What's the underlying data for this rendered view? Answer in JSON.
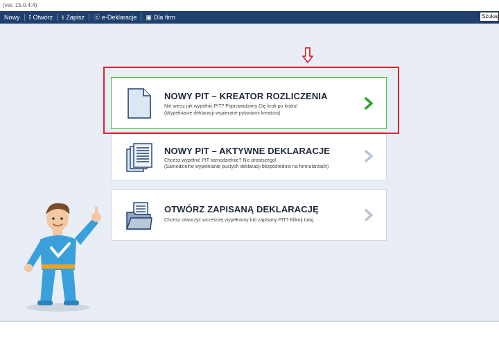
{
  "app": {
    "version": "(ver. 15.0.4.4)"
  },
  "toolbar": {
    "items": [
      {
        "label": "Nowy",
        "icon": ""
      },
      {
        "label": "Otwórz",
        "icon": "upload-icon"
      },
      {
        "label": "Zapisz",
        "icon": "download-icon"
      },
      {
        "label": "e-Deklaracje",
        "icon": "e-declaration-icon"
      },
      {
        "label": "Dla firm",
        "icon": "briefcase-icon"
      }
    ],
    "search_text": "Szukaj"
  },
  "cards": [
    {
      "title": "NOWY PIT – KREATOR ROZLICZENIA",
      "line1": "Nie wiesz jak wypełnić PIT? Poprowadzimy Cię krok po kroku!",
      "line2": "(Wypełnianie deklaracji wspierane pytaniami kreatora)",
      "icon": "blank-document-icon",
      "chevron_color": "#2aa52a"
    },
    {
      "title": "NOWY PIT – AKTYWNE DEKLARACJE",
      "line1": "Chcesz wypełnić PIT samodzielnie? Nic prostszego!",
      "line2": "(Samodzielne wypełnianie pustych deklaracji bezpośrednio na formularzach)",
      "icon": "documents-stack-icon",
      "chevron_color": "#b9c7d6"
    },
    {
      "title": "OTWÓRZ ZAPISANĄ DEKLARACJĘ",
      "line1": "Chcesz otworzyć wcześniej wypełniony lub zapisany PIT? Kliknij tutaj.",
      "icon": "folder-open-icon",
      "chevron_color": "#b9c7d6"
    }
  ],
  "colors": {
    "toolbar_bg": "#1f3f6e",
    "highlight_frame": "#e0202b",
    "selected_card_border": "#43c43a",
    "mascot_suit": "#3aa0dc"
  }
}
